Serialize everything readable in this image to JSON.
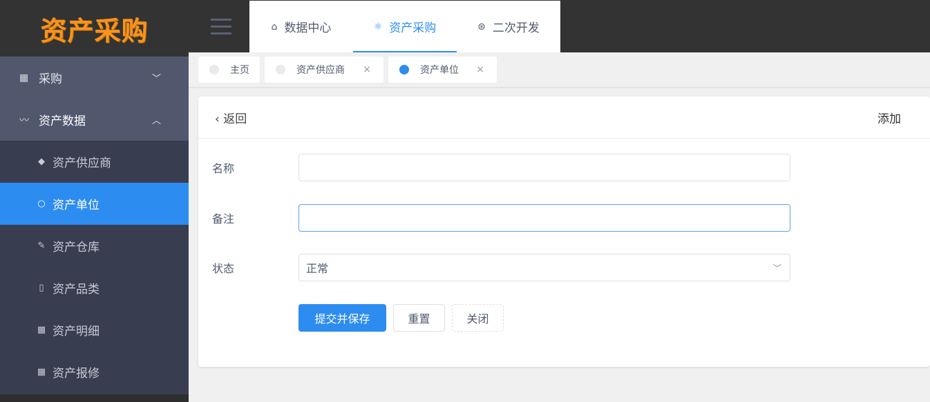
{
  "logo": "资产采购",
  "sidebar": {
    "groups": [
      {
        "label": "采购",
        "icon": "grid-icon",
        "expanded": false
      },
      {
        "label": "资产数据",
        "icon": "pulse-icon",
        "expanded": true
      }
    ],
    "items": [
      {
        "label": "资产供应商",
        "icon": "tag-icon"
      },
      {
        "label": "资产单位",
        "icon": "circle-icon",
        "active": true
      },
      {
        "label": "资产仓库",
        "icon": "brush-icon"
      },
      {
        "label": "资产品类",
        "icon": "phone-icon"
      },
      {
        "label": "资产明细",
        "icon": "grid-icon"
      },
      {
        "label": "资产报修",
        "icon": "grid-icon"
      }
    ]
  },
  "topnav": [
    {
      "label": "数据中心",
      "icon": "home-icon"
    },
    {
      "label": "资产采购",
      "icon": "bulb-icon",
      "active": true
    },
    {
      "label": "二次开发",
      "icon": "aperture-icon"
    }
  ],
  "tabs": [
    {
      "label": "主页"
    },
    {
      "label": "资产供应商",
      "close": "×"
    },
    {
      "label": "资产单位",
      "close": "×",
      "active": true
    }
  ],
  "card": {
    "back": "返回",
    "title": "添加"
  },
  "form": {
    "name_label": "名称",
    "name_value": "",
    "remark_label": "备注",
    "remark_value": "",
    "status_label": "状态",
    "status_value": "正常"
  },
  "buttons": {
    "submit": "提交并保存",
    "reset": "重置",
    "close": "关闭"
  },
  "colors": {
    "accent": "#2d8cf0",
    "logo": "#f7931e"
  }
}
